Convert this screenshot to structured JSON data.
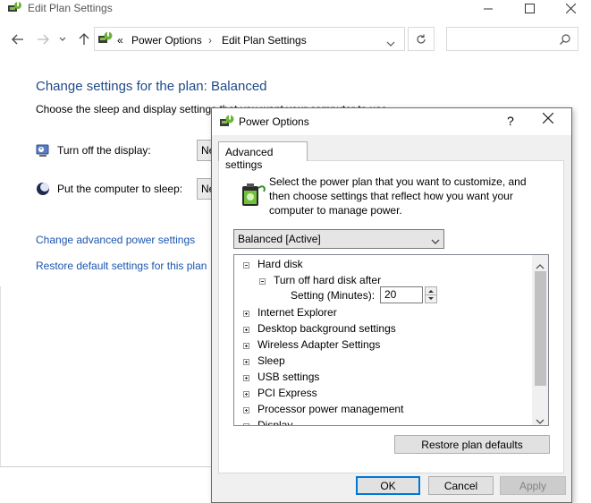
{
  "window": {
    "title": "Edit Plan Settings",
    "minimize_icon": "minimize-icon",
    "maximize_icon": "maximize-icon",
    "close_icon": "close-icon"
  },
  "nav": {
    "back_icon": "back-arrow-icon",
    "forward_icon": "forward-arrow-icon",
    "recent_icon": "chevron-down-icon",
    "up_icon": "up-arrow-icon",
    "breadcrumb_prefix": "«",
    "breadcrumbs": [
      "Power Options",
      "Edit Plan Settings"
    ],
    "refresh_icon": "refresh-icon",
    "search_placeholder": "",
    "search_icon": "search-icon"
  },
  "main": {
    "heading": "Change settings for the plan: Balanced",
    "description": "Choose the sleep and display settings that you want your computer to use.",
    "settings": [
      {
        "label": "Turn off the display:",
        "value": "Ne"
      },
      {
        "label": "Put the computer to sleep:",
        "value": "Ne"
      }
    ],
    "links": {
      "advanced": "Change advanced power settings",
      "restore": "Restore default settings for this plan"
    }
  },
  "dialog": {
    "title": "Power Options",
    "help_label": "?",
    "tab_label": "Advanced settings",
    "intro": "Select the power plan that you want to customize, and then choose settings that reflect how you want your computer to manage power.",
    "plan_selected": "Balanced [Active]",
    "tree": {
      "hard_disk": "Hard disk",
      "turn_off_hard_disk": "Turn off hard disk after",
      "setting_label": "Setting (Minutes):",
      "setting_value": "20",
      "items": [
        "Internet Explorer",
        "Desktop background settings",
        "Wireless Adapter Settings",
        "Sleep",
        "USB settings",
        "PCI Express",
        "Processor power management",
        "Display"
      ]
    },
    "buttons": {
      "restore": "Restore plan defaults",
      "ok": "OK",
      "cancel": "Cancel",
      "apply": "Apply"
    }
  }
}
